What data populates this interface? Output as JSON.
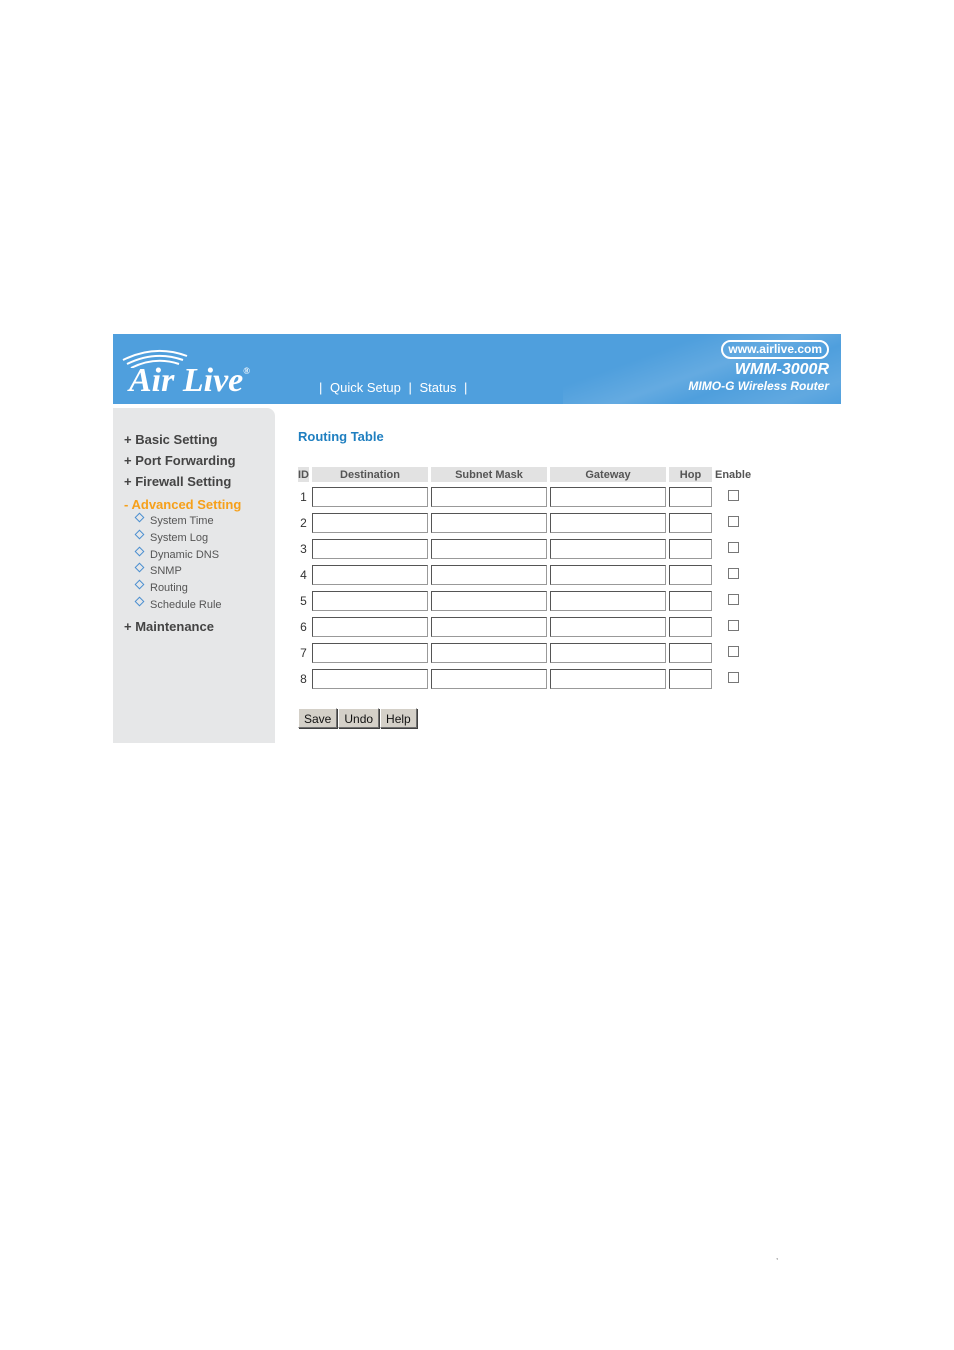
{
  "header": {
    "logo_text": "Air Live",
    "logo_reg": "®",
    "nav": [
      {
        "label": "Quick Setup"
      },
      {
        "label": "Status"
      }
    ],
    "separator": "|",
    "brand_url": "www.airlive.com",
    "model": "WMM-3000R",
    "model_desc": "MIMO-G Wireless Router",
    "colors": {
      "header_bg": "#4f9fdd",
      "active_menu": "#f6a01a",
      "title": "#1f7fc0"
    }
  },
  "sidebar": {
    "items": [
      {
        "prefix": "+",
        "label": "Basic Setting",
        "active": false
      },
      {
        "prefix": "+",
        "label": "Port Forwarding",
        "active": false
      },
      {
        "prefix": "+",
        "label": "Firewall Setting",
        "active": false
      },
      {
        "prefix": "-",
        "label": "Advanced Setting",
        "active": true
      },
      {
        "prefix": "+",
        "label": "Maintenance",
        "active": false
      }
    ],
    "subitems": [
      {
        "label": "System Time"
      },
      {
        "label": "System Log"
      },
      {
        "label": "Dynamic DNS"
      },
      {
        "label": "SNMP"
      },
      {
        "label": "Routing"
      },
      {
        "label": "Schedule Rule"
      }
    ]
  },
  "main": {
    "title": "Routing Table",
    "columns": [
      "ID",
      "Destination",
      "Subnet Mask",
      "Gateway",
      "Hop",
      "Enable"
    ],
    "rows": [
      {
        "id": "1",
        "destination": "",
        "subnet_mask": "",
        "gateway": "",
        "hop": "",
        "enabled": false
      },
      {
        "id": "2",
        "destination": "",
        "subnet_mask": "",
        "gateway": "",
        "hop": "",
        "enabled": false
      },
      {
        "id": "3",
        "destination": "",
        "subnet_mask": "",
        "gateway": "",
        "hop": "",
        "enabled": false
      },
      {
        "id": "4",
        "destination": "",
        "subnet_mask": "",
        "gateway": "",
        "hop": "",
        "enabled": false
      },
      {
        "id": "5",
        "destination": "",
        "subnet_mask": "",
        "gateway": "",
        "hop": "",
        "enabled": false
      },
      {
        "id": "6",
        "destination": "",
        "subnet_mask": "",
        "gateway": "",
        "hop": "",
        "enabled": false
      },
      {
        "id": "7",
        "destination": "",
        "subnet_mask": "",
        "gateway": "",
        "hop": "",
        "enabled": false
      },
      {
        "id": "8",
        "destination": "",
        "subnet_mask": "",
        "gateway": "",
        "hop": "",
        "enabled": false
      }
    ],
    "buttons": {
      "save": "Save",
      "undo": "Undo",
      "help": "Help"
    }
  },
  "page_mark": ","
}
